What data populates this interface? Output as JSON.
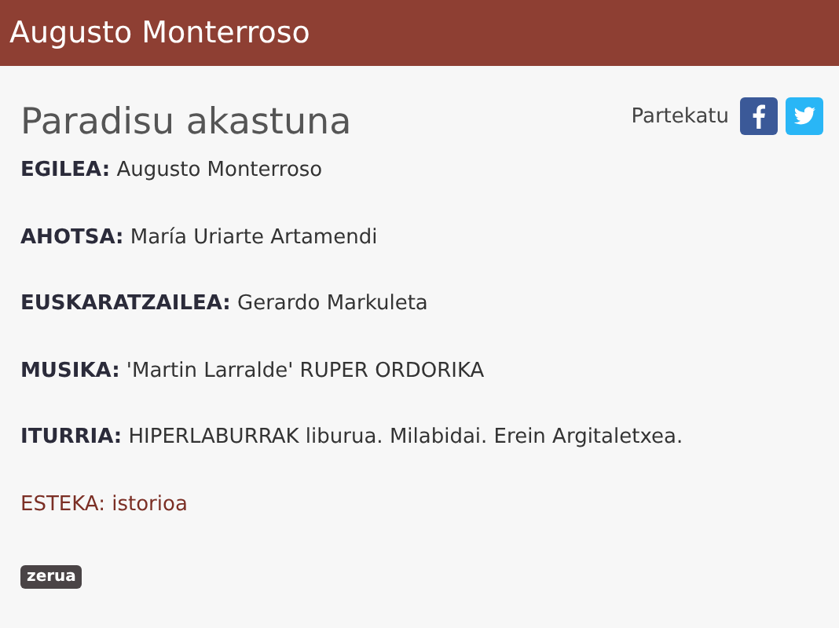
{
  "header": {
    "title": "Augusto Monterroso"
  },
  "story": {
    "title": "Paradisu akastuna"
  },
  "share": {
    "label": "Partekatu"
  },
  "fields": [
    {
      "kind": "field",
      "label": "EGILEA:",
      "value": "Augusto Monterroso"
    },
    {
      "kind": "field",
      "label": "AHOTSA:",
      "value": "María Uriarte Artamendi"
    },
    {
      "kind": "field",
      "label": "EUSKARATZAILEA:",
      "value": "Gerardo Markuleta"
    },
    {
      "kind": "field",
      "label": "MUSIKA:",
      "value": "'Martin Larralde' RUPER ORDORIKA"
    },
    {
      "kind": "field",
      "label": "ITURRIA:",
      "value": "HIPERLABURRAK liburua. Milabidai. Erein Argitaletxea."
    },
    {
      "kind": "link",
      "label": "ESTEKA:",
      "value": "istorioa"
    }
  ],
  "tag": "zerua"
}
